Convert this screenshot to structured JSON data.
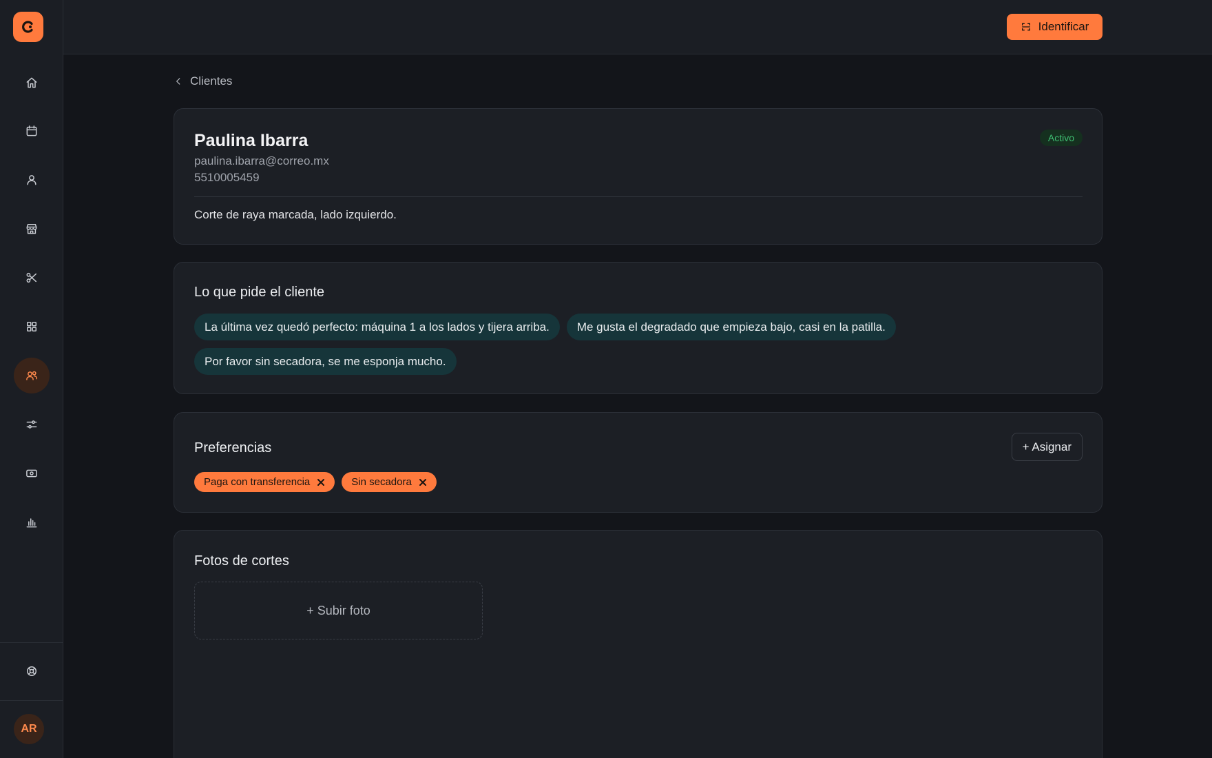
{
  "sidebar": {
    "logo_icon": "logo-c-icon",
    "items": [
      {
        "name": "home",
        "icon": "home-icon"
      },
      {
        "name": "calendar",
        "icon": "calendar-icon"
      },
      {
        "name": "profile",
        "icon": "user-icon"
      },
      {
        "name": "store",
        "icon": "store-icon"
      },
      {
        "name": "services",
        "icon": "scissors-icon"
      },
      {
        "name": "catalog",
        "icon": "grid-icon"
      },
      {
        "name": "clients",
        "icon": "users-icon",
        "active": true
      },
      {
        "name": "settings",
        "icon": "sliders-icon"
      },
      {
        "name": "payments",
        "icon": "cash-icon"
      },
      {
        "name": "reports",
        "icon": "bar-chart-icon"
      }
    ],
    "support_icon": "lifebuoy-icon",
    "avatar_initials": "AR"
  },
  "topbar": {
    "identify_label": "Identificar",
    "identify_icon": "scan-icon"
  },
  "breadcrumb": {
    "back_label": "Clientes"
  },
  "client": {
    "name": "Paulina Ibarra",
    "email": "paulina.ibarra@correo.mx",
    "phone": "5510005459",
    "status": "Activo",
    "note": "Corte de raya marcada, lado izquierdo."
  },
  "requests": {
    "title": "Lo que pide el cliente",
    "items": [
      "La última vez quedó perfecto: máquina 1 a los lados y tijera arriba.",
      "Me gusta el degradado que empieza bajo, casi en la patilla.",
      "Por favor sin secadora, se me esponja mucho."
    ]
  },
  "preferences": {
    "title": "Preferencias",
    "assign_label": "+ Asignar",
    "tags": [
      "Paga con transferencia",
      "Sin secadora"
    ]
  },
  "photos": {
    "title": "Fotos de cortes",
    "upload_label": "+ Subir foto"
  },
  "colors": {
    "accent": "#ff7a3d",
    "background": "#13151a",
    "card": "#1c1f25",
    "status_green": "#3fbf73",
    "chip_teal": "#16353a"
  }
}
